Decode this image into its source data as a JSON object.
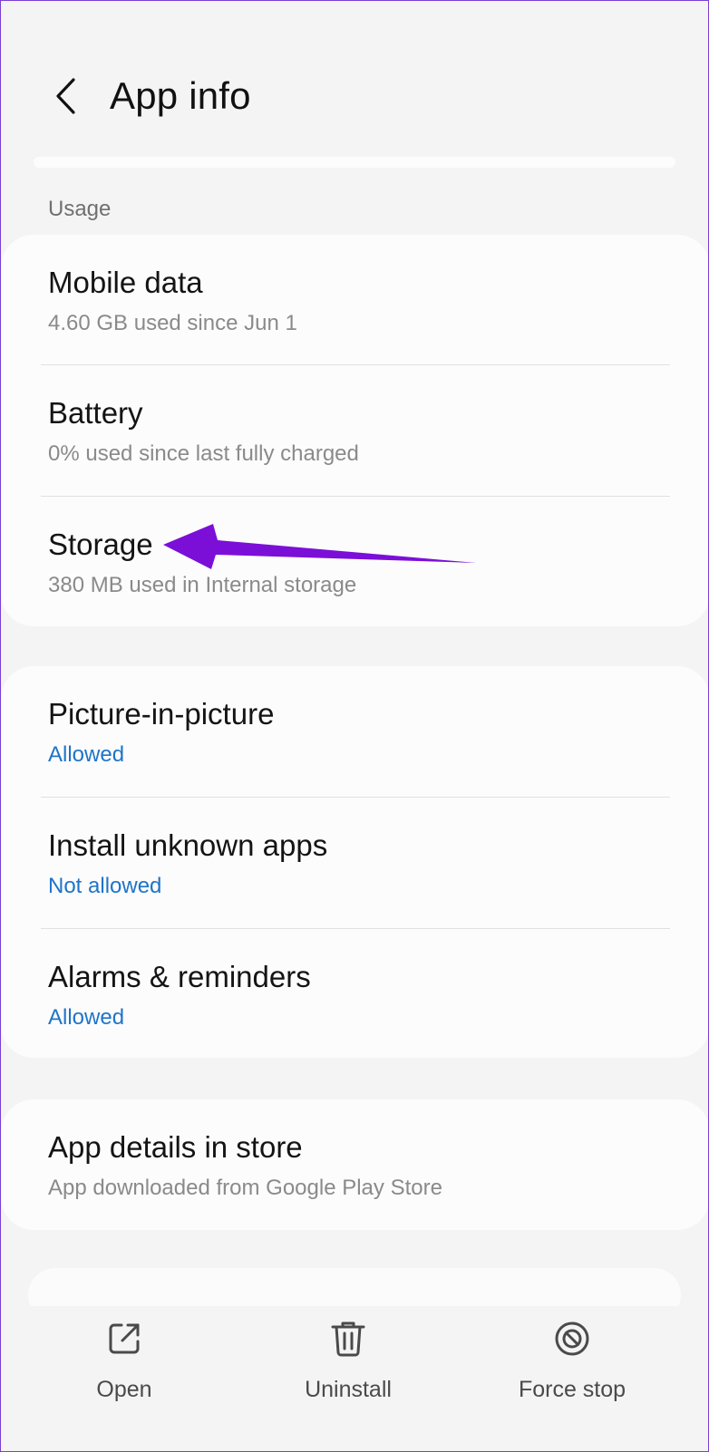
{
  "header": {
    "title": "App info",
    "back_icon": "chevron-left-icon"
  },
  "usage": {
    "section_label": "Usage",
    "items": [
      {
        "label": "Mobile data",
        "sub": "4.60 GB used since Jun 1"
      },
      {
        "label": "Battery",
        "sub": "0% used since last fully charged"
      },
      {
        "label": "Storage",
        "sub": "380 MB used in Internal storage"
      }
    ]
  },
  "permissions": {
    "items": [
      {
        "label": "Picture-in-picture",
        "sub": "Allowed"
      },
      {
        "label": "Install unknown apps",
        "sub": "Not allowed"
      },
      {
        "label": "Alarms & reminders",
        "sub": "Allowed"
      }
    ]
  },
  "store": {
    "items": [
      {
        "label": "App details in store",
        "sub": "App downloaded from Google Play Store"
      }
    ]
  },
  "bottom_actions": [
    {
      "label": "Open",
      "icon": "open-external-icon"
    },
    {
      "label": "Uninstall",
      "icon": "trash-icon"
    },
    {
      "label": "Force stop",
      "icon": "force-stop-icon"
    }
  ],
  "colors": {
    "background": "#f4f4f4",
    "card": "#fcfcfc",
    "link": "#1e74c9",
    "annotation_arrow": "#7b0fd8"
  }
}
